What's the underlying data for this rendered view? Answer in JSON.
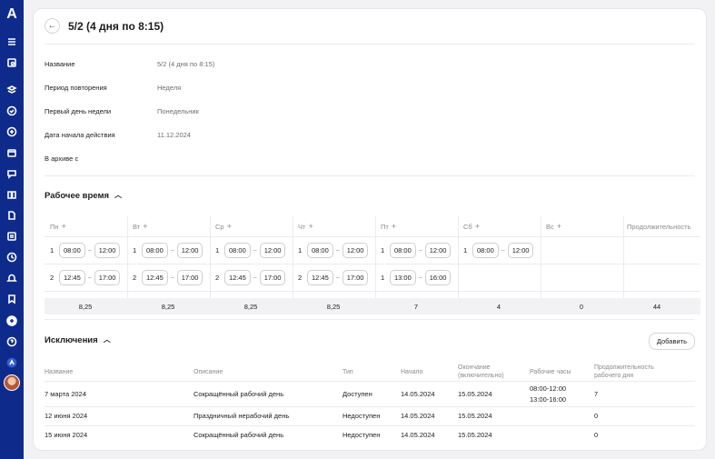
{
  "sidebar": {
    "logo": "A",
    "icons": [
      "menu-icon",
      "search-doc-icon",
      "layers-icon",
      "check-circle-icon",
      "plus-circle-icon",
      "calendar-icon",
      "chat-icon",
      "book-icon",
      "document-icon",
      "list-icon",
      "clock-icon",
      "bell-icon",
      "bookmark-icon",
      "add-circle-icon",
      "help-icon",
      "company-icon"
    ]
  },
  "header": {
    "title": "5/2 (4 дня по 8:15)"
  },
  "info": [
    {
      "label": "Название",
      "value": "5/2 (4 дня по 8:15)"
    },
    {
      "label": "Период повторения",
      "value": "Неделя"
    },
    {
      "label": "Первый день недели",
      "value": "Понедельник"
    },
    {
      "label": "Дата начала действия",
      "value": "11.12.2024"
    },
    {
      "label": "В архиве с",
      "value": ""
    }
  ],
  "work_time": {
    "title": "Рабочее время",
    "days": [
      "Пн",
      "Вт",
      "Ср",
      "Чт",
      "Пт",
      "Сб",
      "Вс"
    ],
    "duration_label": "Продолжительность",
    "rows": [
      {
        "index": "1",
        "slots": [
          [
            "08:00",
            "12:00"
          ],
          [
            "08:00",
            "12:00"
          ],
          [
            "08:00",
            "12:00"
          ],
          [
            "08:00",
            "12:00"
          ],
          [
            "08:00",
            "12:00"
          ],
          [
            "08:00",
            "12:00"
          ],
          null
        ]
      },
      {
        "index": "2",
        "slots": [
          [
            "12:45",
            "17:00"
          ],
          [
            "12:45",
            "17:00"
          ],
          [
            "12:45",
            "17:00"
          ],
          [
            "12:45",
            "17:00"
          ],
          [
            "13:00",
            "16:00"
          ],
          null,
          null
        ]
      }
    ],
    "row2_fri_index": "1",
    "totals": [
      "8,25",
      "8,25",
      "8,25",
      "8,25",
      "7",
      "4",
      "0",
      "44"
    ]
  },
  "exceptions": {
    "title": "Исключения",
    "add_label": "Добавить",
    "headers": [
      "Название",
      "Описание",
      "Тип",
      "Начало",
      "Окончание (включительно)",
      "Рабочие часы",
      "Продолжительность рабочего дня"
    ],
    "rows": [
      {
        "name": "7 марта 2024",
        "desc": "Сокращённый рабочий день",
        "type": "Доступен",
        "start": "14.05.2024",
        "end": "15.05.2024",
        "hours": [
          "08:00-12:00",
          "13:00-16:00"
        ],
        "duration": "7"
      },
      {
        "name": "12 июня 2024",
        "desc": "Праздничный нерабочий день",
        "type": "Недоступен",
        "start": "14.05.2024",
        "end": "15.05.2024",
        "hours": [],
        "duration": "0"
      },
      {
        "name": "15 июня 2024",
        "desc": "Сокращённый рабочий день",
        "type": "Недоступен",
        "start": "14.05.2024",
        "end": "15.05.2024",
        "hours": [],
        "duration": "0"
      }
    ]
  }
}
